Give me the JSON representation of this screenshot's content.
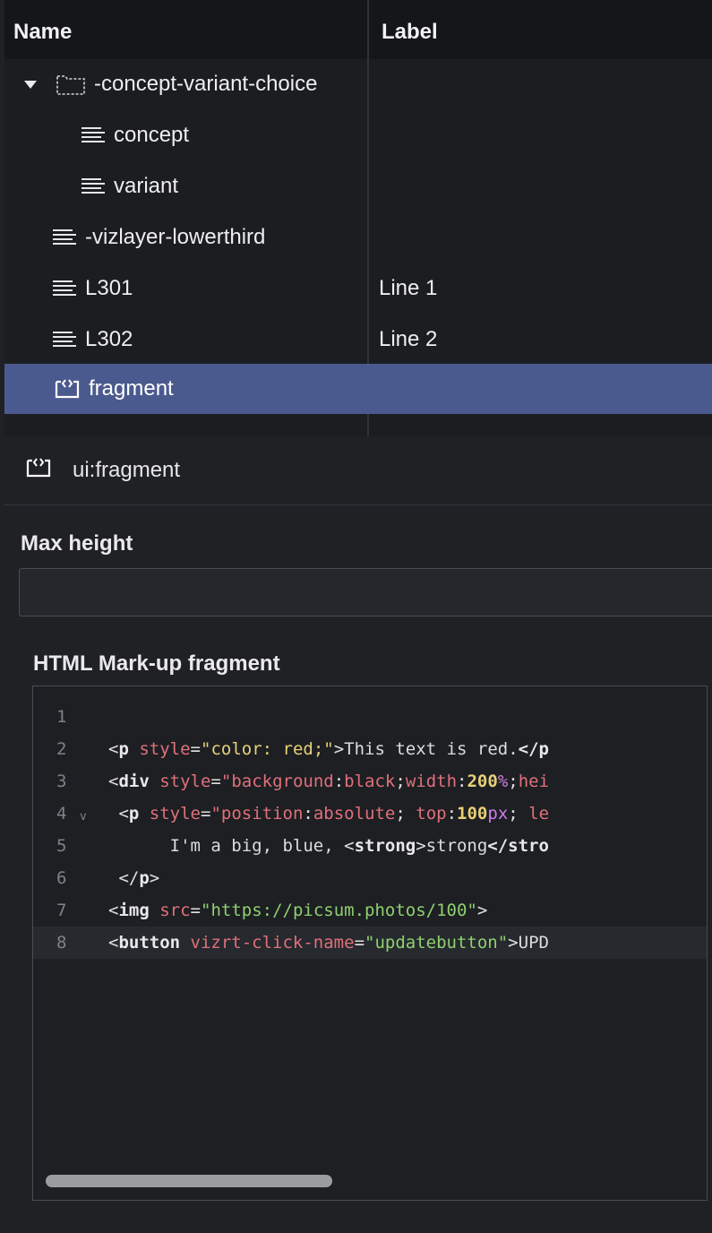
{
  "tree": {
    "columns": {
      "name": "Name",
      "label": "Label"
    },
    "rows": [
      {
        "name": "-concept-variant-choice",
        "label": "",
        "icon": "folder-icon",
        "expanded": true
      },
      {
        "name": "concept",
        "label": "",
        "icon": "text-lines-icon"
      },
      {
        "name": "variant",
        "label": "",
        "icon": "text-lines-icon"
      },
      {
        "name": "-vizlayer-lowerthird",
        "label": "",
        "icon": "text-lines-icon"
      },
      {
        "name": "L301",
        "label": "Line 1",
        "icon": "text-lines-icon"
      },
      {
        "name": "L302",
        "label": "Line 2",
        "icon": "text-lines-icon"
      },
      {
        "name": "fragment",
        "label": "",
        "icon": "fragment-icon",
        "selected": true
      }
    ]
  },
  "properties": {
    "title": "ui:fragment",
    "title_icon": "fragment-icon",
    "max_height": {
      "label": "Max height",
      "value": "",
      "placeholder": ""
    },
    "html_fragment": {
      "label": "HTML Mark-up fragment",
      "line_numbers": [
        "1",
        "2",
        "3",
        "4",
        "5",
        "6",
        "7",
        "8"
      ],
      "fold_marker": "v",
      "l2": {
        "lt": "<",
        "tag": "p",
        "attr": " style",
        "eq": "=",
        "str": "\"color: red;\"",
        "gt": ">",
        "text": "This text is red.",
        "close": "</p"
      },
      "l3": {
        "lt": "<",
        "tag": "div",
        "attr": " style",
        "eq": "=",
        "q1": "\"background",
        "c1": ":",
        "v1": "black",
        "c2": ";",
        "k2": "width",
        "c3": ":",
        "num": "200",
        "pct": "%",
        "c4": ";",
        "k3": "hei"
      },
      "l4": {
        "lead": " ",
        "lt": "<",
        "tag": "p",
        "attr": " style",
        "eq": "=",
        "q1": "\"position",
        "c1": ":",
        "v1": "absolute",
        "c2": "; ",
        "k2": "top",
        "c3": ":",
        "num": "100",
        "unit": "px",
        "c4": "; ",
        "k3": "le"
      },
      "l5": {
        "text": "      I'm a big, blue, ",
        "lt": "<",
        "tag": "strong",
        "gt": ">",
        "inner": "strong",
        "close": "</stro"
      },
      "l6": {
        "lead": " ",
        "close": "</",
        "tag": "p",
        "gt": ">"
      },
      "l7": {
        "lt": "<",
        "tag": "img",
        "attr": " src",
        "eq": "=",
        "str": "\"https://picsum.photos/100\"",
        "gt": ">"
      },
      "l8": {
        "lt": "<",
        "tag": "button",
        "attr": " vizrt-click-name",
        "eq": "=",
        "str": "\"updatebutton\"",
        "gt": ">",
        "text": "UPD"
      }
    }
  },
  "colors": {
    "background": "#1f2125",
    "header": "#14161a",
    "selection": "#4b5a8e",
    "code_attr": "#e0707a",
    "code_string": "#8fd06f",
    "code_number": "#e8d076",
    "code_percent": "#cf7ee6"
  }
}
